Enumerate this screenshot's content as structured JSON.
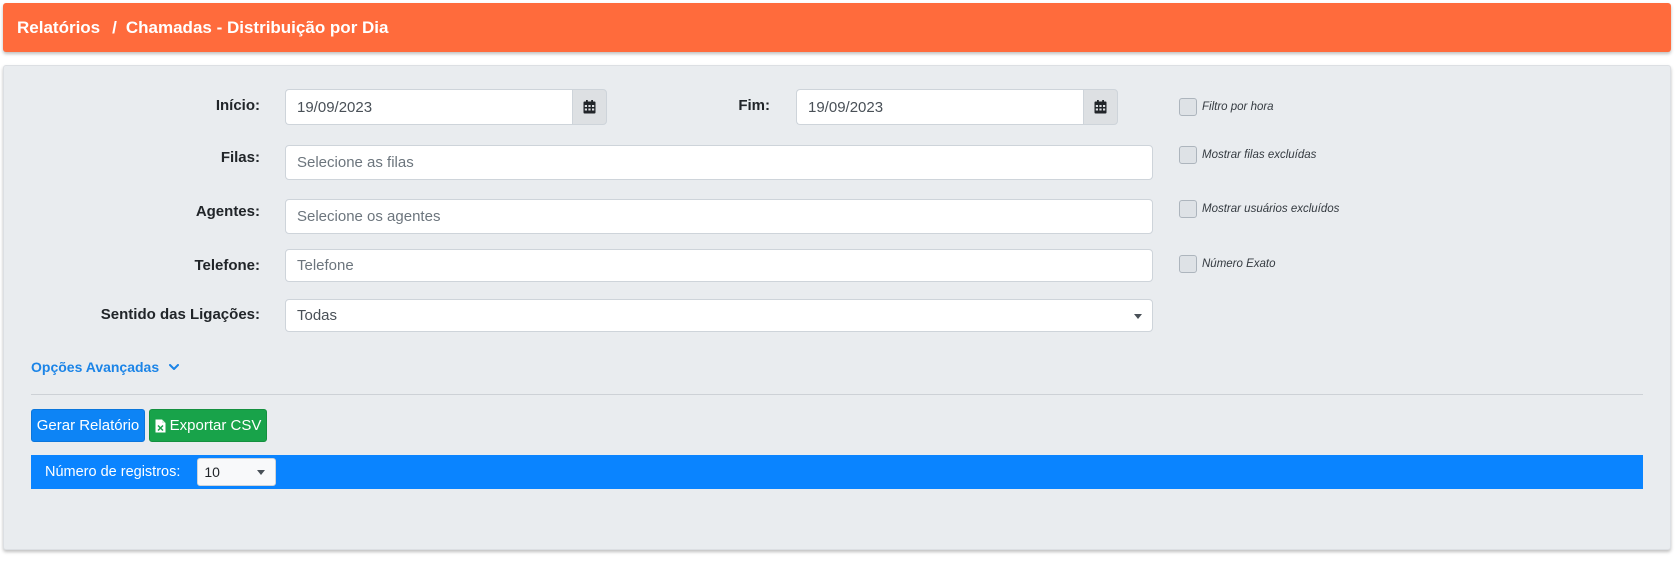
{
  "breadcrumb": {
    "root": "Relatórios",
    "separator": "/",
    "current": "Chamadas - Distribuição por Dia"
  },
  "form": {
    "inicio": {
      "label": "Início:",
      "value": "19/09/2023",
      "icon": "calendar-icon"
    },
    "fim": {
      "label": "Fim:",
      "value": "19/09/2023",
      "icon": "calendar-icon"
    },
    "filas": {
      "label": "Filas:",
      "placeholder": "Selecione as filas"
    },
    "agentes": {
      "label": "Agentes:",
      "placeholder": "Selecione os agentes"
    },
    "telefone": {
      "label": "Telefone:",
      "placeholder": "Telefone"
    },
    "sentido": {
      "label": "Sentido das Ligações:",
      "value": "Todas"
    }
  },
  "checkboxes": {
    "filtro_hora": {
      "label": "Filtro por hora",
      "checked": false
    },
    "filas_excluidas": {
      "label": "Mostrar filas excluídas",
      "checked": false
    },
    "usuarios_excluidos": {
      "label": "Mostrar usuários excluídos",
      "checked": false
    },
    "numero_exato": {
      "label": "Número Exato",
      "checked": false
    }
  },
  "advanced": {
    "label": "Opções Avançadas",
    "icon": "chevron-down-icon"
  },
  "actions": {
    "generate": "Gerar Relatório",
    "export": "Exportar CSV",
    "export_icon": "file-excel-icon"
  },
  "records": {
    "label": "Número de registros:",
    "value": "10"
  },
  "colors": {
    "header": "#ff6b3c",
    "primary": "#0d84f5",
    "success": "#18a34a",
    "link": "#1b84e7",
    "records_bar": "#0a84ff"
  }
}
